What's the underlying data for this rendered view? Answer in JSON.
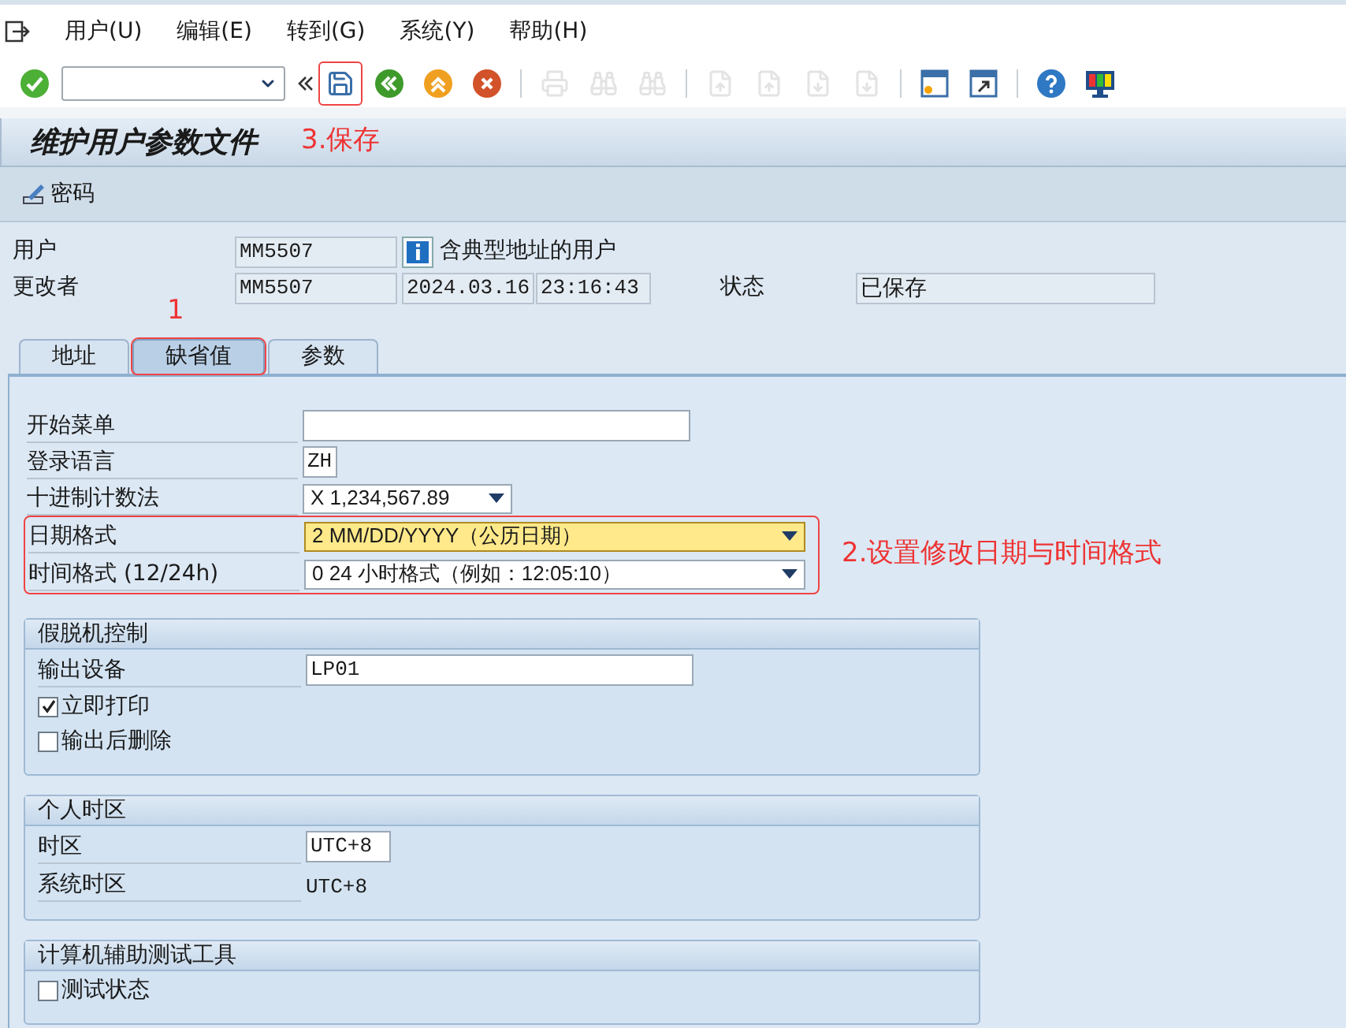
{
  "menu": [
    {
      "label": "用户(U)"
    },
    {
      "label": "编辑(E)"
    },
    {
      "label": "转到(G)"
    },
    {
      "label": "系统(Y)"
    },
    {
      "label": "帮助(H)"
    }
  ],
  "toolbar": [
    {
      "kind": "ok",
      "disabled": false,
      "marked": false
    },
    {
      "kind": "command"
    },
    {
      "kind": "save",
      "disabled": false,
      "marked": true
    },
    {
      "kind": "back",
      "disabled": false,
      "marked": false
    },
    {
      "kind": "exit",
      "disabled": false,
      "marked": false
    },
    {
      "kind": "cancel",
      "disabled": false,
      "marked": false
    },
    {
      "kind": "sep"
    },
    {
      "kind": "print",
      "disabled": true,
      "marked": false
    },
    {
      "kind": "find",
      "disabled": true,
      "marked": false
    },
    {
      "kind": "find-next",
      "disabled": true,
      "marked": false
    },
    {
      "kind": "sep"
    },
    {
      "kind": "first-page",
      "disabled": true,
      "marked": false
    },
    {
      "kind": "prev-page",
      "disabled": true,
      "marked": false
    },
    {
      "kind": "next-page",
      "disabled": true,
      "marked": false
    },
    {
      "kind": "last-page",
      "disabled": true,
      "marked": false
    },
    {
      "kind": "sep"
    },
    {
      "kind": "new-session",
      "disabled": false,
      "marked": false
    },
    {
      "kind": "shortcut",
      "disabled": false,
      "marked": false
    },
    {
      "kind": "sep"
    },
    {
      "kind": "help",
      "disabled": false,
      "marked": false
    },
    {
      "kind": "layout",
      "disabled": false,
      "marked": false
    }
  ],
  "title": "维护用户参数文件",
  "app_toolbar": [
    {
      "label": "密码"
    }
  ],
  "header": {
    "user_label": "用户",
    "user": "MM5507",
    "user_type": "含典型地址的用户",
    "changed_by_label": "更改者",
    "changed_by": "MM5507",
    "date": "2024.03.16",
    "time": "23:16:43",
    "status_label": "状态",
    "status": "已保存"
  },
  "tabs": [
    {
      "label": "地址",
      "selected": false,
      "marked": false
    },
    {
      "label": "缺省值",
      "selected": true,
      "marked": true
    },
    {
      "label": "参数",
      "selected": false,
      "marked": false
    }
  ],
  "defaults": [
    {
      "kind": "input",
      "label": "开始菜单",
      "focused": false,
      "marked": false
    },
    {
      "kind": "input",
      "label": "登录语言",
      "value": "ZH",
      "focused": false,
      "marked": false
    },
    {
      "kind": "dropdown",
      "label": "十进制计数法",
      "value": "X 1,234,567.89",
      "focused": false,
      "marked": false
    },
    {
      "kind": "dropdown",
      "label": "日期格式",
      "value": "2 MM/DD/YYYY（公历日期）",
      "focused": true,
      "marked": true
    },
    {
      "kind": "dropdown",
      "label": "时间格式 (12/24h)",
      "value": "0 24 小时格式（例如：12:05:10）",
      "focused": false,
      "marked": true
    }
  ],
  "groups": [
    {
      "title": "假脱机控制",
      "rows": [
        {
          "kind": "input",
          "label": "输出设备",
          "value": "LP01"
        },
        {
          "kind": "checkbox",
          "label": "立即打印",
          "checked": true
        },
        {
          "kind": "checkbox",
          "label": "输出后删除",
          "checked": false
        }
      ]
    },
    {
      "title": "个人时区",
      "rows": [
        {
          "kind": "input",
          "label": "时区",
          "value": "UTC+8"
        },
        {
          "kind": "readonly",
          "label": "系统时区",
          "value": "UTC+8"
        }
      ]
    },
    {
      "title": "计算机辅助测试工具",
      "rows": [
        {
          "kind": "checkbox",
          "label": "测试状态",
          "checked": false
        }
      ]
    }
  ],
  "annotations": [
    {
      "kind": "save",
      "text": "3.保存"
    },
    {
      "kind": "tab",
      "text": "1"
    },
    {
      "kind": "fields",
      "text": "2.设置修改日期与时间格式"
    }
  ]
}
